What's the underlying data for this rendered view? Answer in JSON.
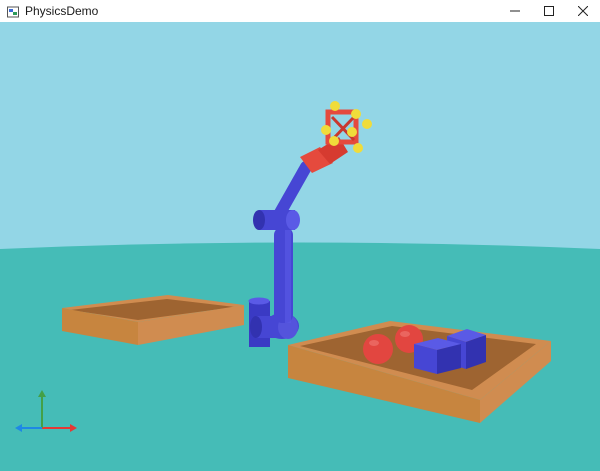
{
  "window": {
    "title": "PhysicsDemo",
    "controls": {
      "minimize_icon": "minimize-icon",
      "maximize_icon": "maximize-icon",
      "close_icon": "close-icon"
    }
  },
  "scene": {
    "colors": {
      "sky": "#93d6e6",
      "ground": "#45bcb7",
      "tray": "#d08c50",
      "tray_dark": "#9e6431",
      "arm": "#4646d4",
      "arm_dark": "#2d2d9e",
      "gripper": "#e54a3d",
      "gripper_joints": "#f0dc3a",
      "ball": "#e24640",
      "axis_x": "#e53935",
      "axis_y": "#43a047",
      "axis_z": "#1e88e5"
    }
  }
}
